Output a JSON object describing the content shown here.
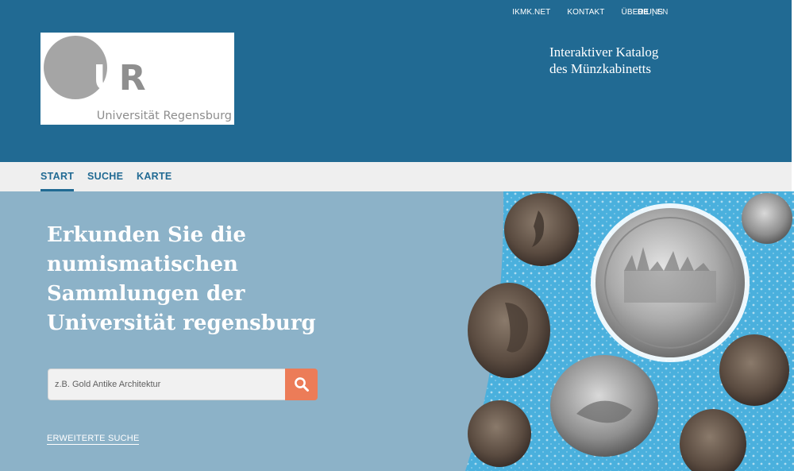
{
  "topnav": {
    "items": [
      "IKMK.NET",
      "KONTAKT",
      "ÜBER UNS"
    ],
    "lang_active": "DE",
    "lang_separator": "|",
    "lang_other": "EN"
  },
  "logo": {
    "letters_u": "U",
    "letters_r": "R",
    "name": "Universität Regensburg"
  },
  "catalog": {
    "line1": "Interaktiver Katalog",
    "line2": "des Münzkabinetts"
  },
  "mainnav": {
    "items": [
      "START",
      "SUCHE",
      "KARTE"
    ]
  },
  "hero": {
    "title": "Erkunden Sie die numismatischen Sammlungen der Universität regensburg",
    "search_placeholder": "z.B. Gold Antike Architektur",
    "advanced_search": "ERWEITERTE SUCHE"
  },
  "colors": {
    "header_blue": "#216a93",
    "hero_blue": "#8cb2c8",
    "search_button": "#ec7c58",
    "nav_bg": "#efefef"
  },
  "icons": {
    "search": "magnifier-icon"
  }
}
